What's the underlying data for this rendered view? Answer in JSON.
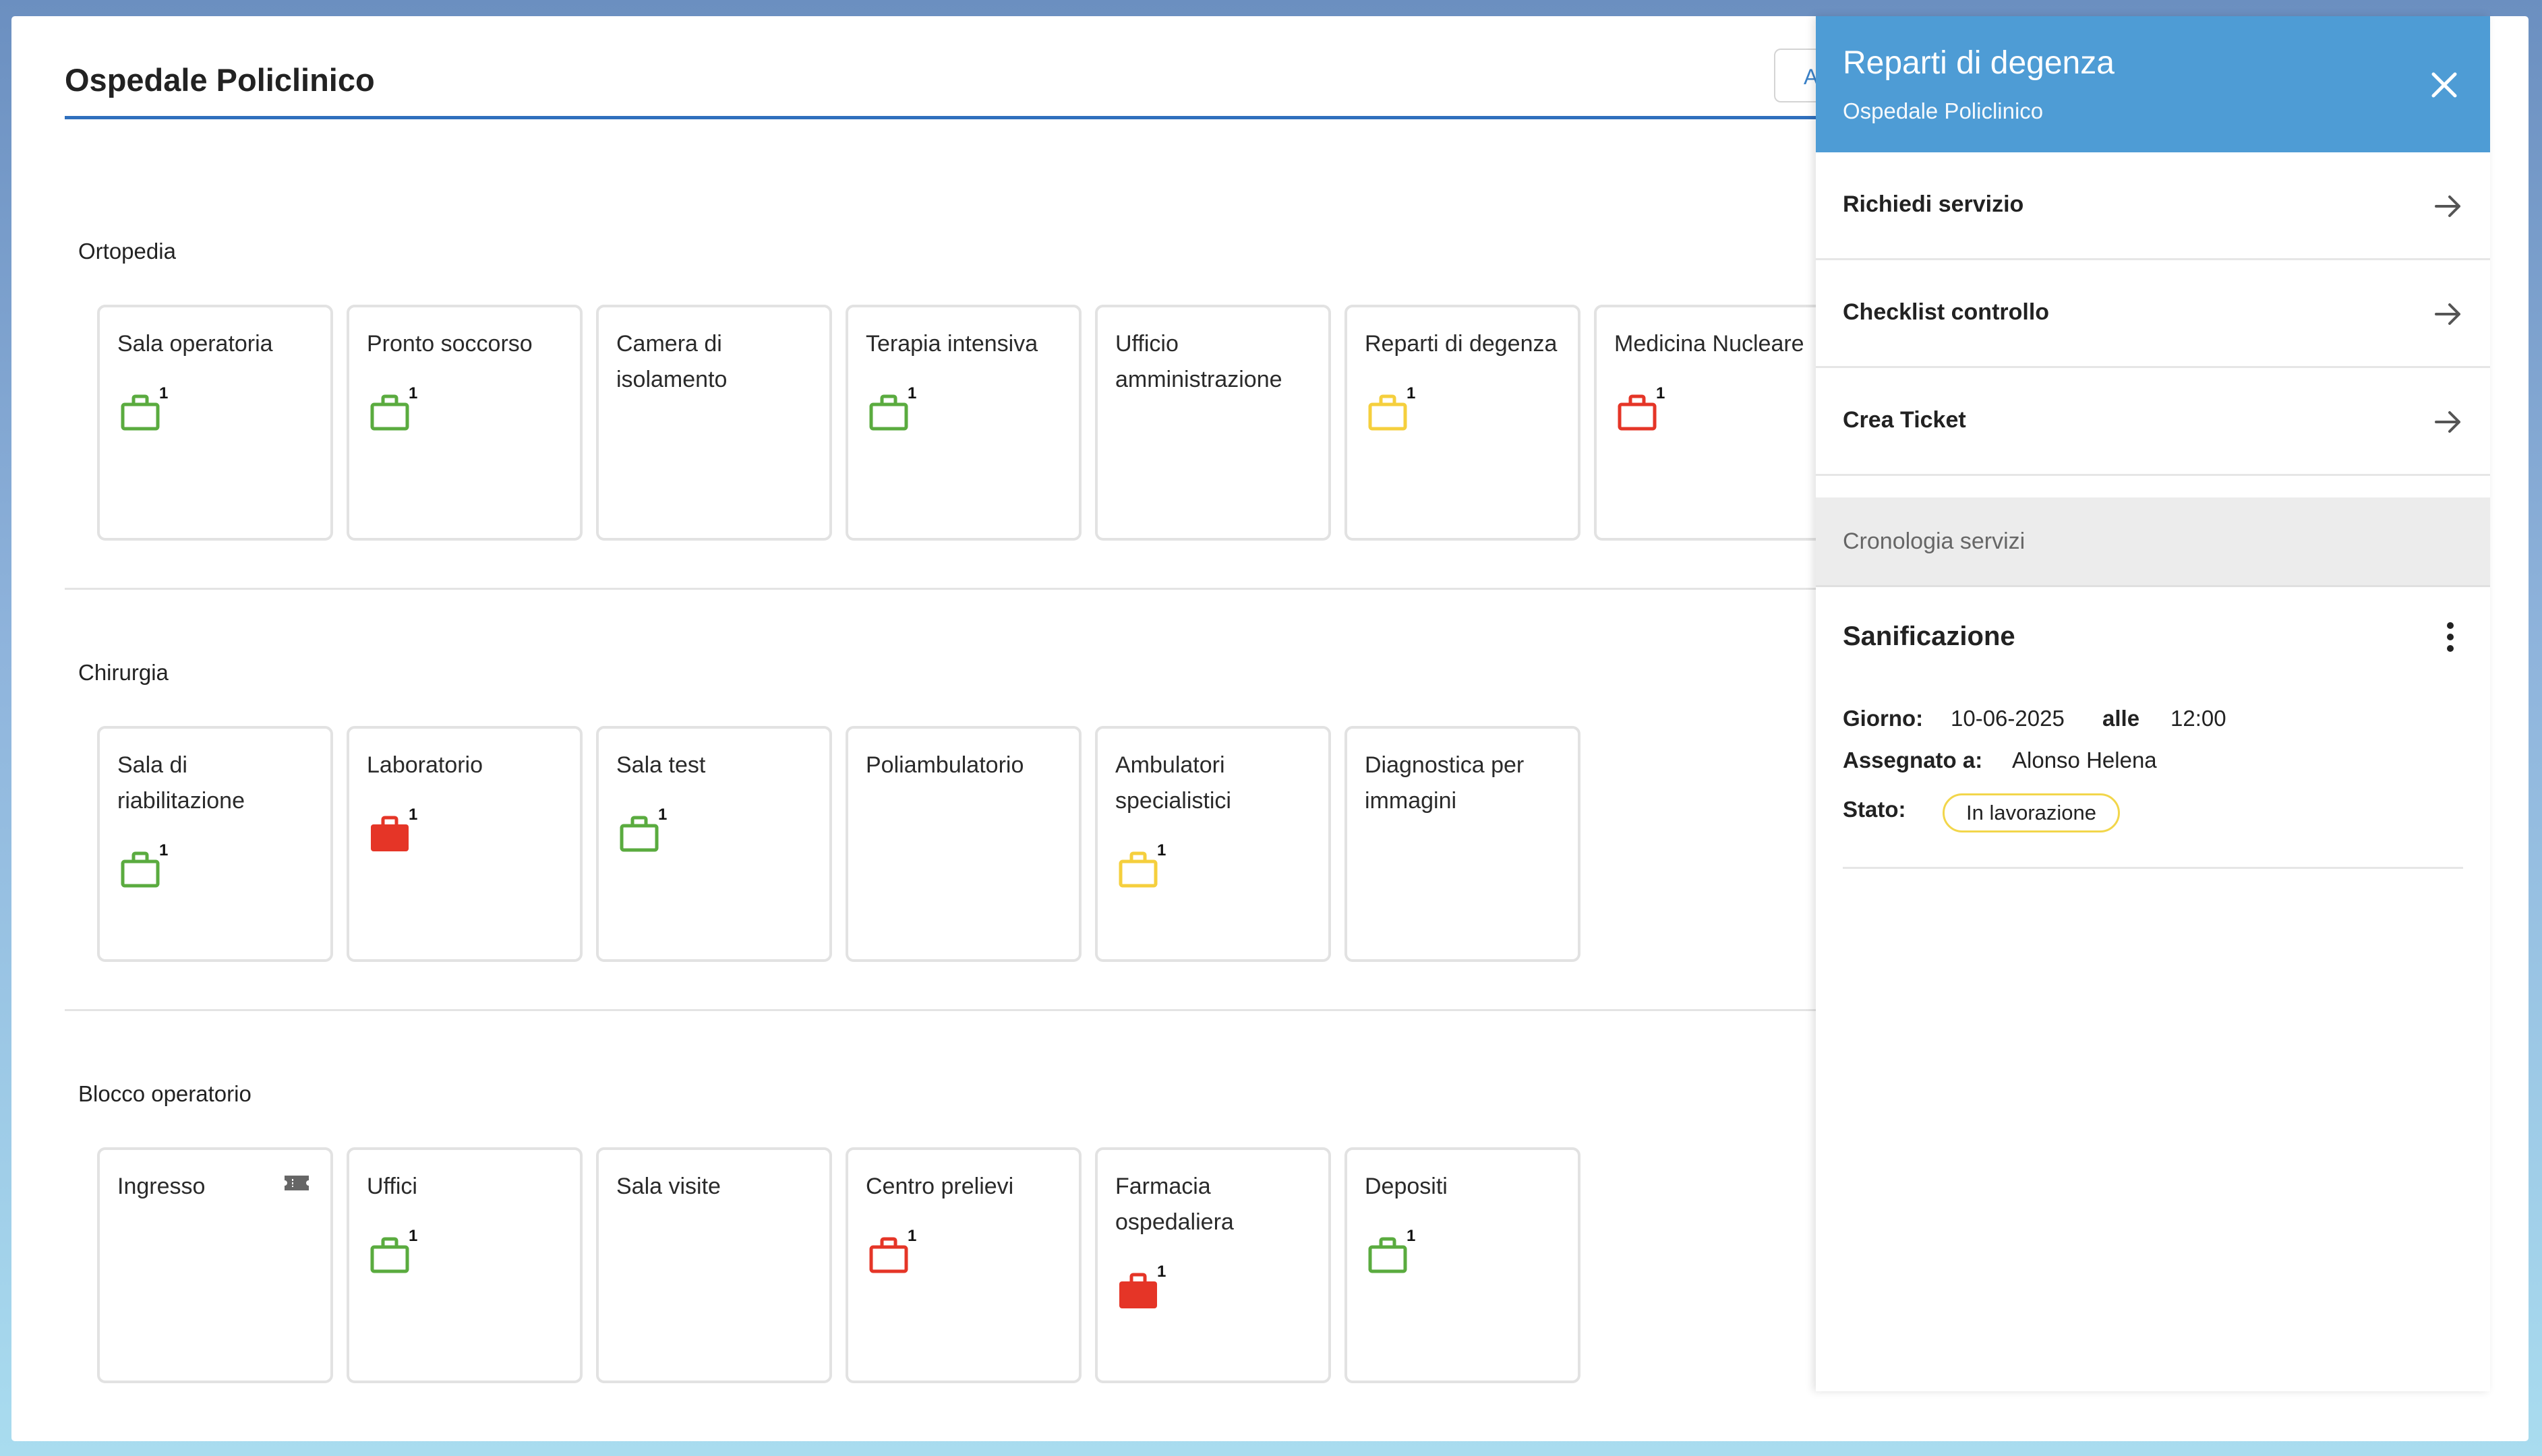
{
  "page": {
    "title": "Ospedale Policlinico",
    "top_button_label": "Az"
  },
  "colors": {
    "green": "#5aab3f",
    "yellow": "#f5cf3d",
    "red": "#e53527",
    "accent": "#4e9cd5"
  },
  "sections": [
    {
      "title": "Ortopedia",
      "rooms": [
        {
          "name": "Sala operatoria",
          "icon": "briefcase-outline-green-icon",
          "count": "1"
        },
        {
          "name": "Pronto soccorso",
          "icon": "briefcase-outline-green-icon",
          "count": "1"
        },
        {
          "name": "Camera di isolamento"
        },
        {
          "name": "Terapia intensiva",
          "icon": "briefcase-outline-green-icon",
          "count": "1"
        },
        {
          "name": "Ufficio amministrazione"
        },
        {
          "name": "Reparti di degenza",
          "icon": "briefcase-outline-yellow-icon",
          "count": "1"
        },
        {
          "name": "Medicina Nucleare",
          "icon": "briefcase-outline-red-icon",
          "count": "1"
        }
      ]
    },
    {
      "title": "Chirurgia",
      "rooms": [
        {
          "name": "Sala di riabilitazione",
          "icon": "briefcase-outline-green-icon",
          "count": "1"
        },
        {
          "name": "Laboratorio",
          "icon": "briefcase-filled-red-icon",
          "count": "1"
        },
        {
          "name": "Sala test",
          "icon": "briefcase-outline-green-icon",
          "count": "1"
        },
        {
          "name": "Poliambulatorio"
        },
        {
          "name": "Ambulatori specialistici",
          "icon": "briefcase-outline-yellow-icon",
          "count": "1"
        },
        {
          "name": "Diagnostica per immagini"
        }
      ]
    },
    {
      "title": "Blocco operatorio",
      "rooms": [
        {
          "name": "Ingresso",
          "corner_icon": "ticket-icon"
        },
        {
          "name": "Uffici",
          "icon": "briefcase-outline-green-icon",
          "count": "1"
        },
        {
          "name": "Sala visite"
        },
        {
          "name": "Centro prelievi",
          "icon": "briefcase-outline-red-icon",
          "count": "1"
        },
        {
          "name": "Farmacia ospedaliera",
          "icon": "briefcase-filled-red-icon",
          "count": "1"
        },
        {
          "name": "Depositi",
          "icon": "briefcase-outline-green-icon",
          "count": "1"
        }
      ]
    }
  ],
  "panel": {
    "title": "Reparti di degenza",
    "subtitle": "Ospedale Policlinico",
    "close_icon": "close-icon",
    "actions": [
      {
        "label": "Richiedi servizio",
        "icon": "arrow-right-icon"
      },
      {
        "label": "Checklist controllo",
        "icon": "arrow-right-icon"
      },
      {
        "label": "Crea Ticket",
        "icon": "arrow-right-icon"
      }
    ],
    "history_label": "Cronologia servizi",
    "service": {
      "title": "Sanificazione",
      "menu_icon": "kebab-menu-icon",
      "day_label": "Giorno:",
      "day_value": "10-06-2025",
      "time_label": "alle",
      "time_value": "12:00",
      "assignee_label": "Assegnato a:",
      "assignee_value": "Alonso Helena",
      "status_label": "Stato:",
      "status_value": "In lavorazione"
    }
  }
}
